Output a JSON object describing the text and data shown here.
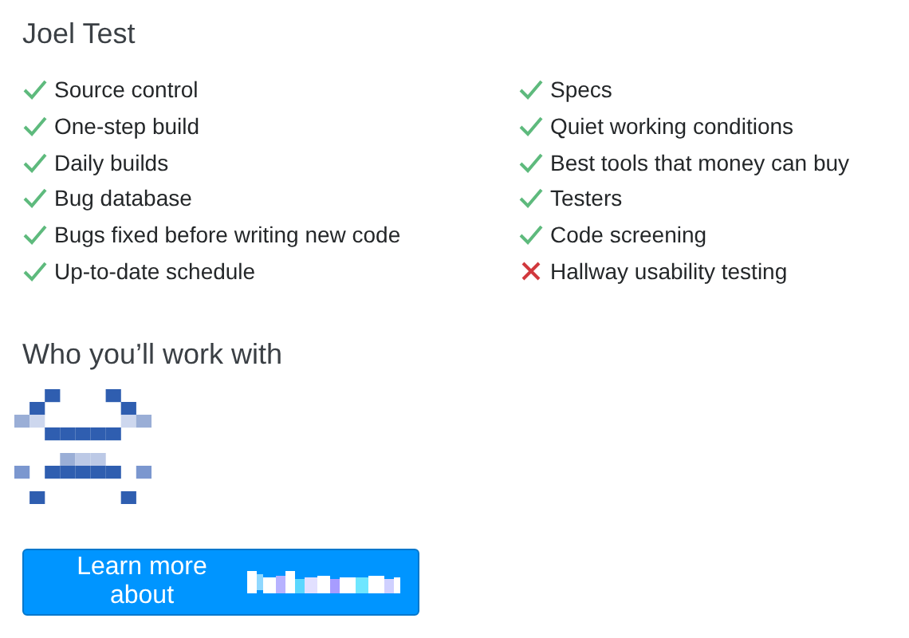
{
  "joel_test": {
    "title": "Joel Test",
    "columns": [
      [
        {
          "label": "Source control",
          "met": true
        },
        {
          "label": "One-step build",
          "met": true
        },
        {
          "label": "Daily builds",
          "met": true
        },
        {
          "label": "Bug database",
          "met": true
        },
        {
          "label": "Bugs fixed before writing new code",
          "met": true
        },
        {
          "label": "Up-to-date schedule",
          "met": true
        }
      ],
      [
        {
          "label": "Specs",
          "met": true
        },
        {
          "label": "Quiet working conditions",
          "met": true
        },
        {
          "label": "Best tools that money can buy",
          "met": true
        },
        {
          "label": "Testers",
          "met": true
        },
        {
          "label": "Code screening",
          "met": true
        },
        {
          "label": "Hallway usability testing",
          "met": false
        }
      ]
    ]
  },
  "team": {
    "title": "Who you’ll work with"
  },
  "learn_more_button": {
    "label": "Learn more about"
  }
}
